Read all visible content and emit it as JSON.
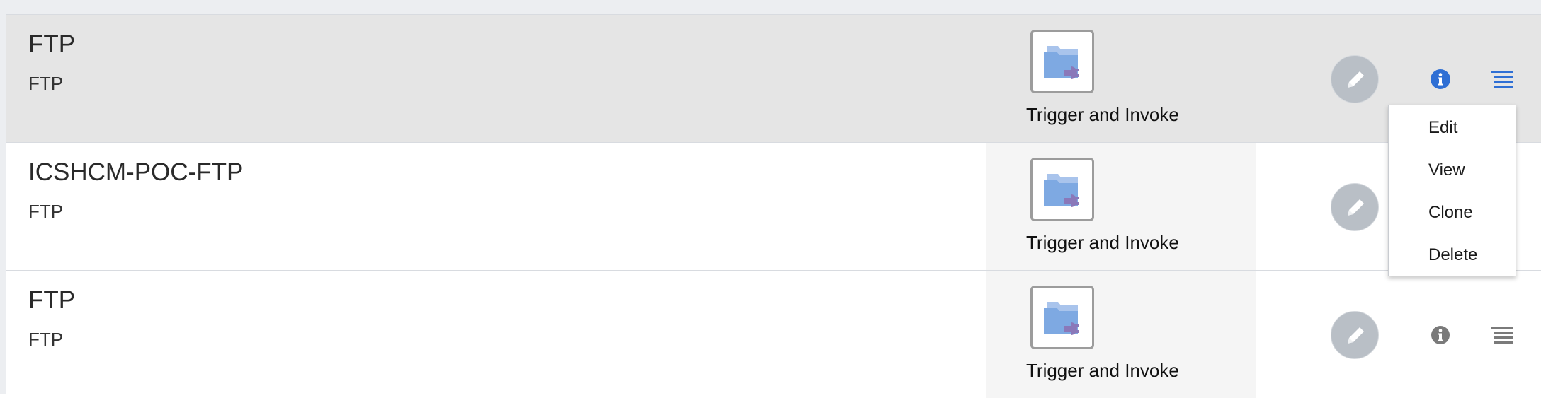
{
  "connections": [
    {
      "name": "FTP",
      "type": "FTP",
      "adapter_role": "Trigger and Invoke",
      "adapter_icon": "ftp-adapter-icon",
      "selected": true
    },
    {
      "name": "ICSHCM-POC-FTP",
      "type": "FTP",
      "adapter_role": "Trigger and Invoke",
      "adapter_icon": "ftp-adapter-icon",
      "selected": false
    },
    {
      "name": "FTP",
      "type": "FTP",
      "adapter_role": "Trigger and Invoke",
      "adapter_icon": "ftp-adapter-icon",
      "selected": false
    }
  ],
  "row_actions": {
    "edit_icon": "pencil-icon",
    "info_icon": "info-icon",
    "menu_icon": "hamburger-menu-icon"
  },
  "action_menu": {
    "items": [
      "Edit",
      "View",
      "Clone",
      "Delete"
    ]
  },
  "colors": {
    "selected_row": "#e5e5e5",
    "info_active": "#2f6fd4",
    "icon_inactive": "#7a7a7a",
    "edit_button": "#b9bfc6"
  }
}
